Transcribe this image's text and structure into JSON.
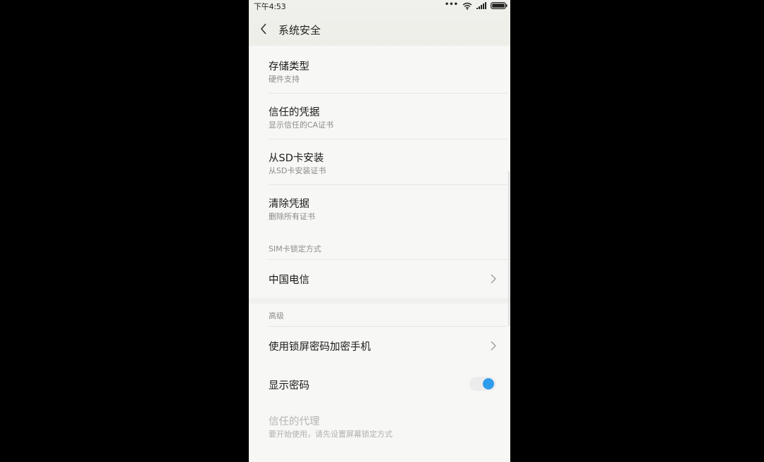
{
  "status_bar": {
    "time": "下午4:53",
    "icons": [
      "more-dots-icon",
      "wifi-icon",
      "signal-icon",
      "battery-icon"
    ]
  },
  "header": {
    "title": "系统安全",
    "back_icon": "back-arrow-icon"
  },
  "items": [
    {
      "title": "存储类型",
      "subtitle": "硬件支持"
    },
    {
      "title": "信任的凭据",
      "subtitle": "显示信任的CA证书"
    },
    {
      "title": "从SD卡安装",
      "subtitle": "从SD卡安装证书"
    },
    {
      "title": "清除凭据",
      "subtitle": "删除所有证书"
    }
  ],
  "sim_section": {
    "label": "SIM卡锁定方式",
    "carrier": "中国电信"
  },
  "advanced_section": {
    "label": "高级",
    "encrypt": "使用锁屏密码加密手机",
    "show_password": "显示密码",
    "show_password_on": true,
    "trust_agent_title": "信任的代理",
    "trust_agent_subtitle": "要开始使用，请先设置屏幕锁定方式",
    "next_item_title": "…"
  },
  "colors": {
    "accent": "#2f9ceb",
    "background": "#f7f7f5"
  }
}
